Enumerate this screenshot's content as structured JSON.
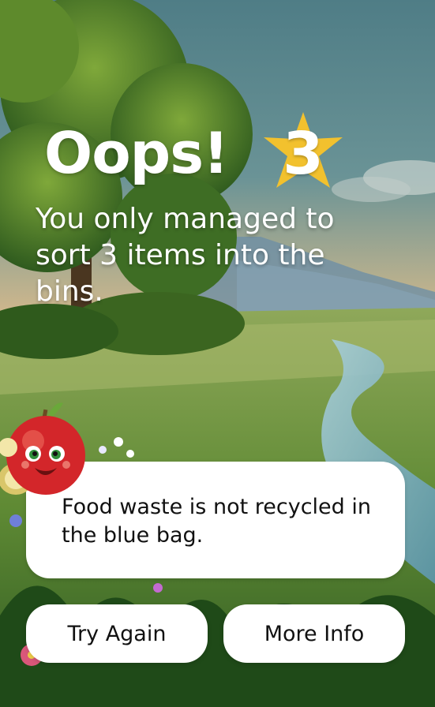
{
  "result": {
    "title": "Oops!",
    "score": "3",
    "message": "You only managed to sort 3 items into the bins."
  },
  "info_card": {
    "text": "Food waste is not recycled in the blue bag."
  },
  "buttons": {
    "try_again": "Try Again",
    "more_info": "More Info"
  },
  "colors": {
    "star": "#F2C12E",
    "panel": "#FFFFFF",
    "title_text": "#FFFFFF"
  },
  "icons": {
    "score_badge": "star-icon",
    "mascot": "apple-mascot-icon"
  }
}
